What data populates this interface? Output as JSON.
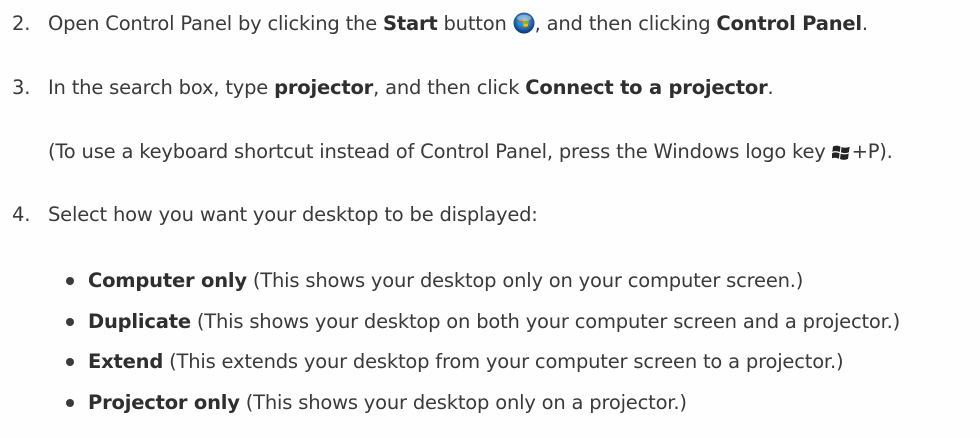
{
  "steps": [
    {
      "num": "2.",
      "t1": "Open Control Panel by clicking the ",
      "b1": "Start",
      "t2": " button ",
      "icon": "windows-start-orb-icon",
      "t3": ", and then clicking ",
      "b2": "Control Panel",
      "t4": "."
    },
    {
      "num": "3.",
      "t1": "In the search box, type ",
      "b1": "projector",
      "t2": ", and then click ",
      "b2": "Connect to a projector",
      "t3": "."
    },
    {
      "note_t1": "(To use a keyboard shortcut instead of Control Panel, press the Windows logo key ",
      "icon": "windows-logo-key-icon",
      "note_t2": "+P)."
    },
    {
      "num": "4.",
      "t1": "Select how you want your desktop to be displayed:"
    }
  ],
  "options": [
    {
      "bold": "Computer only",
      "desc": " (This shows your desktop only on your computer screen.)"
    },
    {
      "bold": "Duplicate",
      "desc": " (This shows your desktop on both your computer screen and a projector.)"
    },
    {
      "bold": "Extend",
      "desc": " (This extends your desktop from your computer screen to a projector.)"
    },
    {
      "bold": "Projector only",
      "desc": " (This shows your desktop only on a projector.)"
    }
  ]
}
